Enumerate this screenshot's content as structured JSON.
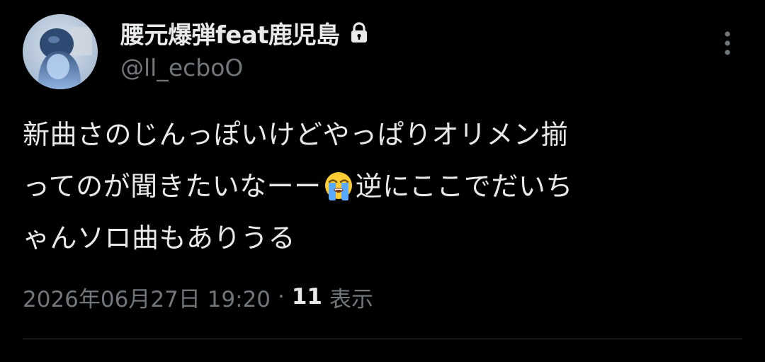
{
  "author": {
    "display_name": "腰元爆弾feat鹿児島",
    "handle": "@ll_ecboO",
    "protected": true
  },
  "tweet": {
    "lines": [
      {
        "text": "新曲さのじんっぽいけどやっぱりオリメン揃"
      },
      {
        "before": "ってのが聞きたいなーー",
        "emoji": "loudly-crying-face",
        "after": "逆にここでだいち"
      },
      {
        "text": "ゃんソロ曲もありうる"
      }
    ]
  },
  "meta": {
    "timestamp": "2026年06月27日 19:20",
    "separator": "·",
    "views_count": "11",
    "views_label": "表示"
  },
  "icons": {
    "lock": "lock-icon",
    "more": "more-vertical-icon"
  },
  "colors": {
    "background": "#000000",
    "primary_text": "#e7e9ea",
    "secondary_text": "#71767b",
    "divider": "#2f3336"
  }
}
